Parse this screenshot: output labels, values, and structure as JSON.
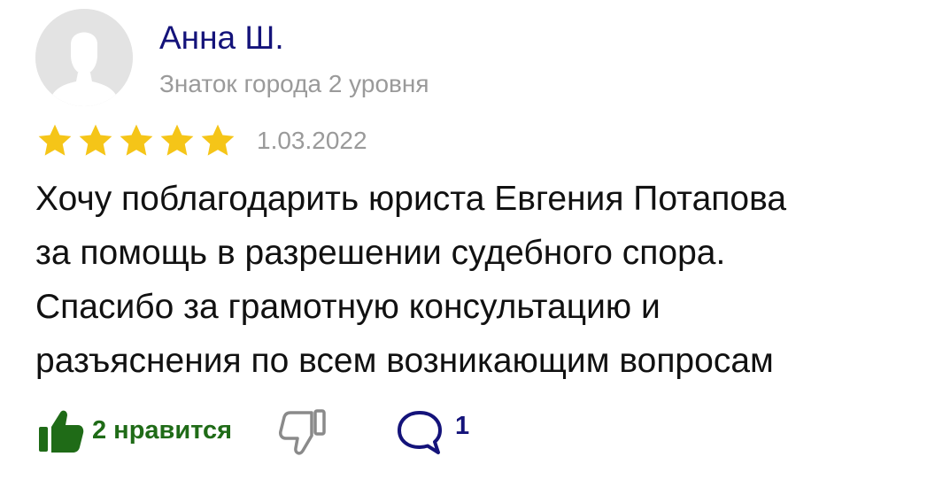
{
  "author": {
    "name": "Анна Ш.",
    "rank": "Знаток города 2 уровня",
    "avatar_icon": "user-silhouette-icon"
  },
  "review": {
    "rating": 5,
    "rating_max": 5,
    "date": "1.03.2022",
    "text_lines": [
      "Хочу поблагодарить юриста Евгения Потапова",
      "за помощь в разрешении судебного спора.",
      "Спасибо за грамотную консультацию и",
      "разъяснения по всем возникающим вопросам"
    ]
  },
  "actions": {
    "like_label": "2 нравится",
    "comment_count": "1",
    "like_icon": "thumbs-up-icon",
    "dislike_icon": "thumbs-down-icon",
    "comment_icon": "comment-bubble-icon"
  },
  "colors": {
    "author_name": "#14137a",
    "secondary_text": "#9a9a9a",
    "star": "#f5c518",
    "like": "#1f6b17",
    "dislike_outline": "#8a8a8a",
    "comment": "#14137a"
  }
}
